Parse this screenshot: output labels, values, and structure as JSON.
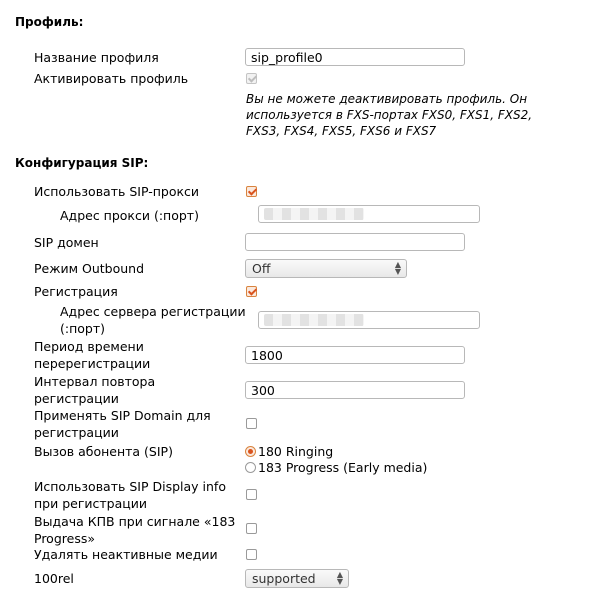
{
  "sections": {
    "profile_title": "Профиль:",
    "sip_title": "Конфигурация SIP:"
  },
  "profile": {
    "name_label": "Название профиля",
    "name_value": "sip_profile0",
    "activate_label": "Активировать профиль",
    "activate_checked": true,
    "activate_note": "Вы не можете деактивировать профиль. Он используется в FXS-портах FXS0, FXS1, FXS2, FXS3, FXS4, FXS5, FXS6 и FXS7"
  },
  "sip": {
    "use_proxy_label": "Использовать SIP-прокси",
    "use_proxy_checked": true,
    "proxy_address_label": "Адрес прокси (:порт)",
    "sip_domain_label": "SIP домен",
    "sip_domain_value": "",
    "outbound_mode_label": "Режим Outbound",
    "outbound_mode_value": "Off",
    "registration_label": "Регистрация",
    "registration_checked": true,
    "reg_server_label": "Адрес сервера регистрации (:порт)",
    "rereg_period_label": "Период времени перерегистрации",
    "rereg_period_value": "1800",
    "retry_interval_label": "Интервал повтора регистрации",
    "retry_interval_value": "300",
    "apply_domain_label": "Применять SIP Domain для регистрации",
    "apply_domain_checked": false,
    "subscriber_call_label": "Вызов абонента (SIP)",
    "subscriber_call_options": [
      "180 Ringing",
      "183 Progress (Early media)"
    ],
    "subscriber_call_selected": "180 Ringing",
    "display_info_label": "Использовать SIP Display info при регистрации",
    "display_info_checked": false,
    "kpv_label": "Выдача КПВ при сигнале «183 Progress»",
    "kpv_checked": false,
    "remove_inactive_media_label": "Удалять неактивные медии",
    "remove_inactive_media_checked": false,
    "rel100_label": "100rel",
    "rel100_value": "supported"
  },
  "colors": {
    "accent": "#d9531e",
    "border": "#b8b8b8"
  }
}
